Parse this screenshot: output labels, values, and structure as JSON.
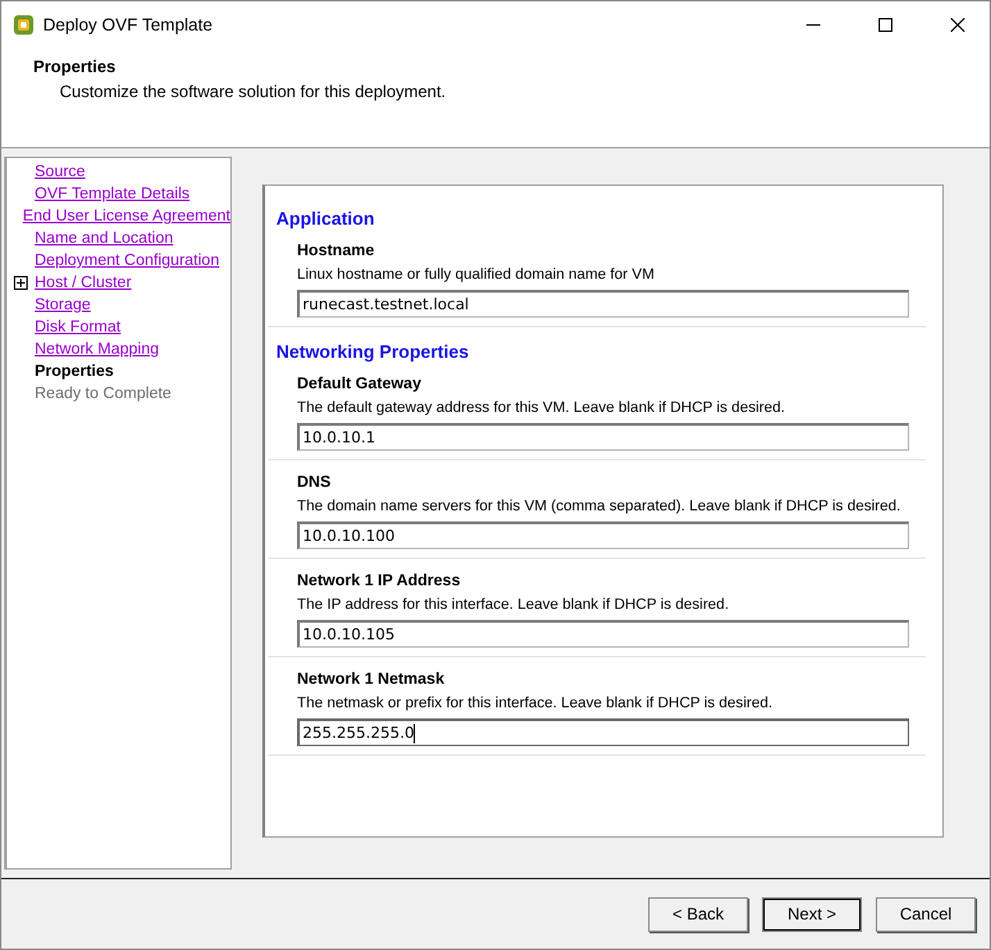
{
  "window": {
    "title": "Deploy OVF Template"
  },
  "header": {
    "title": "Properties",
    "subtitle": "Customize the software solution for this deployment."
  },
  "steps": [
    {
      "label": "Source",
      "selected": false,
      "disabled": false,
      "expandable": false
    },
    {
      "label": "OVF Template Details",
      "selected": false,
      "disabled": false,
      "expandable": false
    },
    {
      "label": "End User License Agreement",
      "selected": false,
      "disabled": false,
      "expandable": false
    },
    {
      "label": "Name and Location",
      "selected": false,
      "disabled": false,
      "expandable": false
    },
    {
      "label": "Deployment Configuration",
      "selected": false,
      "disabled": false,
      "expandable": false
    },
    {
      "label": "Host / Cluster",
      "selected": false,
      "disabled": false,
      "expandable": true
    },
    {
      "label": "Storage",
      "selected": false,
      "disabled": false,
      "expandable": false
    },
    {
      "label": "Disk Format",
      "selected": false,
      "disabled": false,
      "expandable": false
    },
    {
      "label": "Network Mapping",
      "selected": false,
      "disabled": false,
      "expandable": false
    },
    {
      "label": "Properties",
      "selected": true,
      "disabled": false,
      "expandable": false
    },
    {
      "label": "Ready to Complete",
      "selected": false,
      "disabled": true,
      "expandable": false
    }
  ],
  "sections": [
    {
      "heading": "Application",
      "fields": [
        {
          "label": "Hostname",
          "description": "Linux hostname or fully qualified domain name for VM",
          "value": "runecast.testnet.local",
          "focused": false
        }
      ]
    },
    {
      "heading": "Networking Properties",
      "fields": [
        {
          "label": "Default Gateway",
          "description": "The default gateway address for this VM. Leave blank if DHCP is desired.",
          "value": "10.0.10.1",
          "focused": false
        },
        {
          "label": "DNS",
          "description": "The domain name servers for this VM (comma separated). Leave blank if DHCP is desired.",
          "value": "10.0.10.100",
          "focused": false
        },
        {
          "label": "Network 1 IP Address",
          "description": "The IP address for this interface. Leave blank if DHCP is desired.",
          "value": "10.0.10.105",
          "focused": false
        },
        {
          "label": "Network 1 Netmask",
          "description": "The netmask or prefix for this interface. Leave blank if DHCP is desired.",
          "value": "255.255.255.0",
          "focused": true
        }
      ]
    }
  ],
  "buttons": [
    {
      "label": "< Back",
      "default": false
    },
    {
      "label": "Next >",
      "default": true
    },
    {
      "label": "Cancel",
      "default": false
    }
  ]
}
